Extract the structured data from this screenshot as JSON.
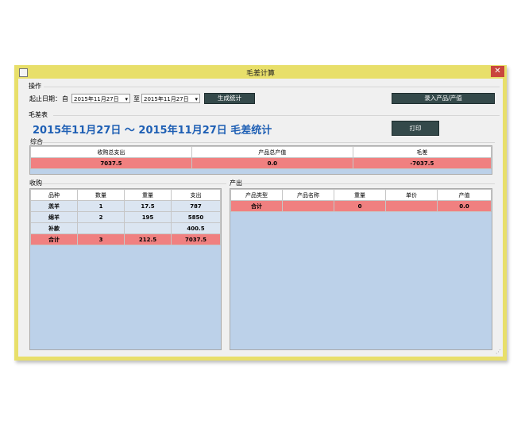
{
  "window": {
    "title": "毛差计算",
    "close_symbol": "✕"
  },
  "ops": {
    "group_label": "操作",
    "date_range_label": "起止日期：",
    "from_label": "自",
    "to_label": "至",
    "start_date": "2015年11月27日",
    "end_date": "2015年11月27日",
    "dropdown_arrow": "▾",
    "generate_button": "生成统计",
    "entry_button": "录入产品/产值"
  },
  "report": {
    "group_label": "毛差表",
    "heading": "2015年11月27日 ～ 2015年11月27日 毛差统计",
    "print_button": "打印"
  },
  "summary": {
    "label": "综合",
    "columns": [
      "收购总支出",
      "产品总产值",
      "毛差"
    ],
    "values": [
      "7037.5",
      "0.0",
      "-7037.5"
    ]
  },
  "purchase": {
    "label": "收购",
    "columns": [
      "品种",
      "数量",
      "重量",
      "支出"
    ],
    "rows": [
      [
        "羔羊",
        "1",
        "17.5",
        "787"
      ],
      [
        "绵羊",
        "2",
        "195",
        "5850"
      ],
      [
        "补款",
        "",
        "",
        "400.5"
      ]
    ],
    "total": [
      "合计",
      "3",
      "212.5",
      "7037.5"
    ]
  },
  "output": {
    "label": "产出",
    "columns": [
      "产品类型",
      "产品名称",
      "重量",
      "单价",
      "产值"
    ],
    "total": [
      "合计",
      "",
      "0",
      "",
      "0.0"
    ]
  },
  "colors": {
    "heading": "#1e5fb4",
    "total_row": "#f08080",
    "panel": "#bcd1e9",
    "frame": "#e8df6a",
    "button": "#34494a"
  }
}
